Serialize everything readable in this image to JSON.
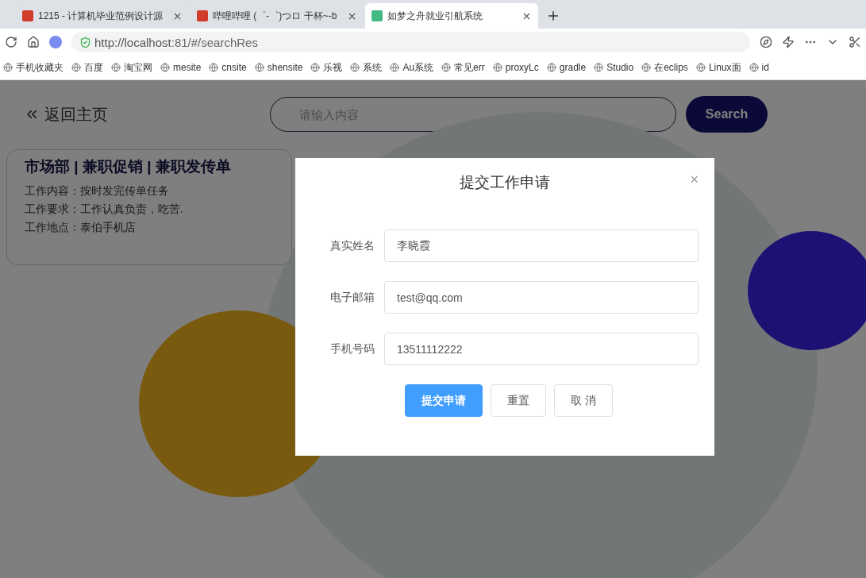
{
  "browser": {
    "tabs": [
      {
        "title": "1215 - 计算机毕业范例设计源",
        "selected": false
      },
      {
        "title": "哔哩哔哩 (゜-゜)つロ 干杯~-b",
        "selected": false
      },
      {
        "title": "如梦之舟就业引航系统",
        "selected": true
      }
    ],
    "address": {
      "host": "http://localhost",
      "rest": ":81/#/searchRes"
    },
    "bookmarks": [
      "手机收藏夹",
      "百度",
      "淘宝网",
      "mesite",
      "cnsite",
      "shensite",
      "乐视",
      "系统",
      "Au系统",
      "常见err",
      "proxyLc",
      "gradle",
      "Studio",
      "在eclips",
      "Linux面",
      "id"
    ]
  },
  "page": {
    "back_link": "返回主页",
    "search": {
      "placeholder": "请输入内容",
      "button": "Search"
    },
    "job_card": {
      "title": "市场部 | 兼职促销 | 兼职发传单",
      "lines": [
        "工作内容：按时发完传单任务",
        "工作要求：工作认真负责，吃苦.",
        "工作地点：泰伯手机店"
      ]
    }
  },
  "dialog": {
    "title": "提交工作申请",
    "close": "×",
    "fields": [
      {
        "label": "真实姓名",
        "value": "李晓霞"
      },
      {
        "label": "电子邮箱",
        "value": "test@qq.com"
      },
      {
        "label": "手机号码",
        "value": "13511112222"
      }
    ],
    "buttons": [
      {
        "label": "提交申请",
        "kind": "primary"
      },
      {
        "label": "重置",
        "kind": "default"
      },
      {
        "label": "取 消",
        "kind": "default"
      }
    ]
  }
}
